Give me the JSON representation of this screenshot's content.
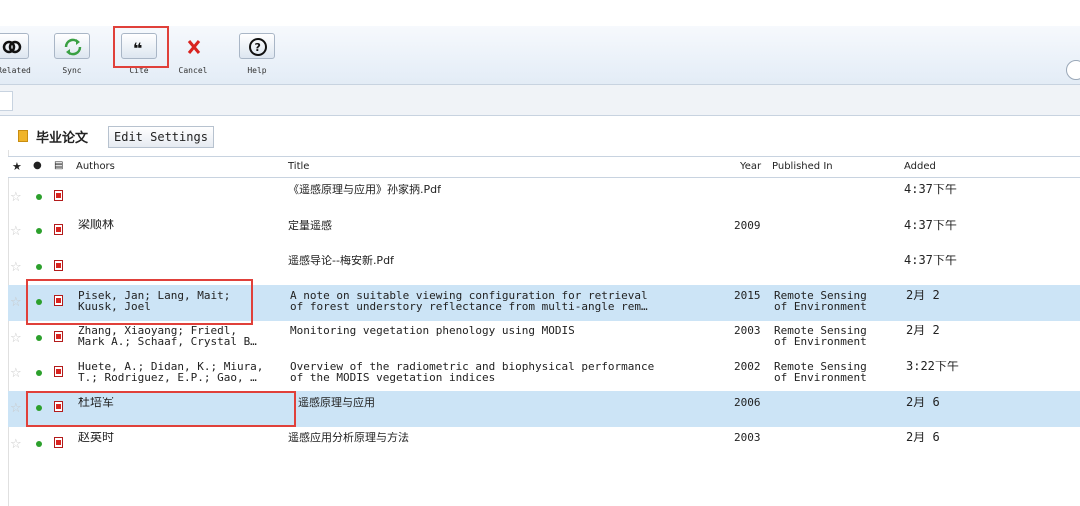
{
  "toolbar": {
    "buttons": [
      {
        "label": "Related",
        "icon": "related-icon"
      },
      {
        "label": "Sync",
        "icon": "sync-icon"
      },
      {
        "label": "Cite",
        "icon": "quote-icon"
      },
      {
        "label": "Cancel",
        "icon": "cancel-icon"
      },
      {
        "label": "Help",
        "icon": "help-icon"
      }
    ]
  },
  "collection": {
    "name": "毕业论文",
    "edit_label": "Edit Settings"
  },
  "table": {
    "headers": {
      "authors": "Authors",
      "title": "Title",
      "year": "Year",
      "published_in": "Published In",
      "added": "Added"
    },
    "rows": [
      {
        "authors1": "",
        "authors2": "",
        "title1": "《遥感原理与应用》孙家抦.Pdf",
        "title2": "",
        "year": "",
        "pub1": "",
        "pub2": "",
        "added": "4:37下午"
      },
      {
        "authors1": "梁顺林",
        "authors2": "",
        "title1": "定量遥感",
        "title2": "",
        "year": "2009",
        "pub1": "",
        "pub2": "",
        "added": "4:37下午"
      },
      {
        "authors1": "",
        "authors2": "",
        "title1": "遥感导论--梅安新.Pdf",
        "title2": "",
        "year": "",
        "pub1": "",
        "pub2": "",
        "added": "4:37下午"
      },
      {
        "authors1": "Pisek, Jan; Lang, Mait;",
        "authors2": "Kuusk, Joel",
        "title1": "A note on suitable viewing configuration for retrieval",
        "title2": "of forest understory reflectance from multi-angle rem…",
        "year": "2015",
        "pub1": "Remote Sensing",
        "pub2": "of Environment",
        "added": "2月 2"
      },
      {
        "authors1": "Zhang, Xiaoyang; Friedl,",
        "authors2": "Mark A.; Schaaf, Crystal B…",
        "title1": "Monitoring vegetation phenology using MODIS",
        "title2": "",
        "year": "2003",
        "pub1": "Remote Sensing",
        "pub2": "of Environment",
        "added": "2月 2"
      },
      {
        "authors1": "Huete, A.; Didan, K.; Miura,",
        "authors2": "T.; Rodriguez, E.P.; Gao, …",
        "title1": "Overview of the radiometric and biophysical performance",
        "title2": "of the MODIS vegetation indices",
        "year": "2002",
        "pub1": "Remote Sensing",
        "pub2": "of Environment",
        "added": "3:22下午"
      },
      {
        "authors1": "杜培军",
        "authors2": "",
        "title1": "遥感原理与应用",
        "title2": "",
        "year": "2006",
        "pub1": "",
        "pub2": "",
        "added": "2月 6"
      },
      {
        "authors1": "赵英时",
        "authors2": "",
        "title1": "遥感应用分析原理与方法",
        "title2": "",
        "year": "2003",
        "pub1": "",
        "pub2": "",
        "added": "2月 6"
      }
    ]
  },
  "colors": {
    "accent": "#e0403a",
    "sync": "#3aa043",
    "cancel": "#d9231f",
    "selected_row": "#cce4f6"
  }
}
